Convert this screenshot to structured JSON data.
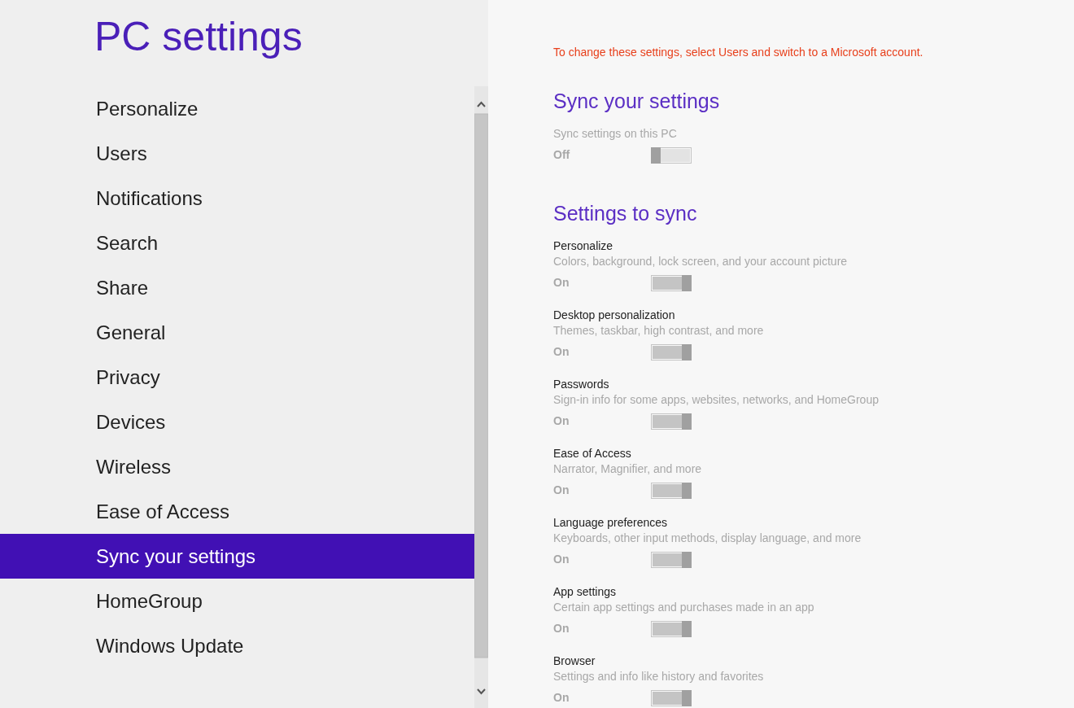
{
  "title": "PC settings",
  "nav": [
    {
      "label": "Personalize",
      "selected": false
    },
    {
      "label": "Users",
      "selected": false
    },
    {
      "label": "Notifications",
      "selected": false
    },
    {
      "label": "Search",
      "selected": false
    },
    {
      "label": "Share",
      "selected": false
    },
    {
      "label": "General",
      "selected": false
    },
    {
      "label": "Privacy",
      "selected": false
    },
    {
      "label": "Devices",
      "selected": false
    },
    {
      "label": "Wireless",
      "selected": false
    },
    {
      "label": "Ease of Access",
      "selected": false
    },
    {
      "label": "Sync your settings",
      "selected": true
    },
    {
      "label": "HomeGroup",
      "selected": false
    },
    {
      "label": "Windows Update",
      "selected": false
    }
  ],
  "notice": "To change these settings, select Users and switch to a Microsoft account.",
  "sync_section": {
    "heading": "Sync your settings",
    "label": "Sync settings on this PC",
    "state_text": "Off",
    "on": false,
    "disabled": true
  },
  "settings_section": {
    "heading": "Settings to sync",
    "items": [
      {
        "name": "Personalize",
        "description": "Colors, background, lock screen, and your account picture",
        "state_text": "On",
        "on": true,
        "disabled": true
      },
      {
        "name": "Desktop personalization",
        "description": "Themes, taskbar, high contrast, and more",
        "state_text": "On",
        "on": true,
        "disabled": true
      },
      {
        "name": "Passwords",
        "description": "Sign-in info for some apps, websites, networks, and HomeGroup",
        "state_text": "On",
        "on": true,
        "disabled": true
      },
      {
        "name": "Ease of Access",
        "description": "Narrator, Magnifier, and more",
        "state_text": "On",
        "on": true,
        "disabled": true
      },
      {
        "name": "Language preferences",
        "description": "Keyboards, other input methods, display language, and more",
        "state_text": "On",
        "on": true,
        "disabled": true
      },
      {
        "name": "App settings",
        "description": "Certain app settings and purchases made in an app",
        "state_text": "On",
        "on": true,
        "disabled": true
      },
      {
        "name": "Browser",
        "description": "Settings and info like history and favorites",
        "state_text": "On",
        "on": true,
        "disabled": true
      }
    ]
  }
}
